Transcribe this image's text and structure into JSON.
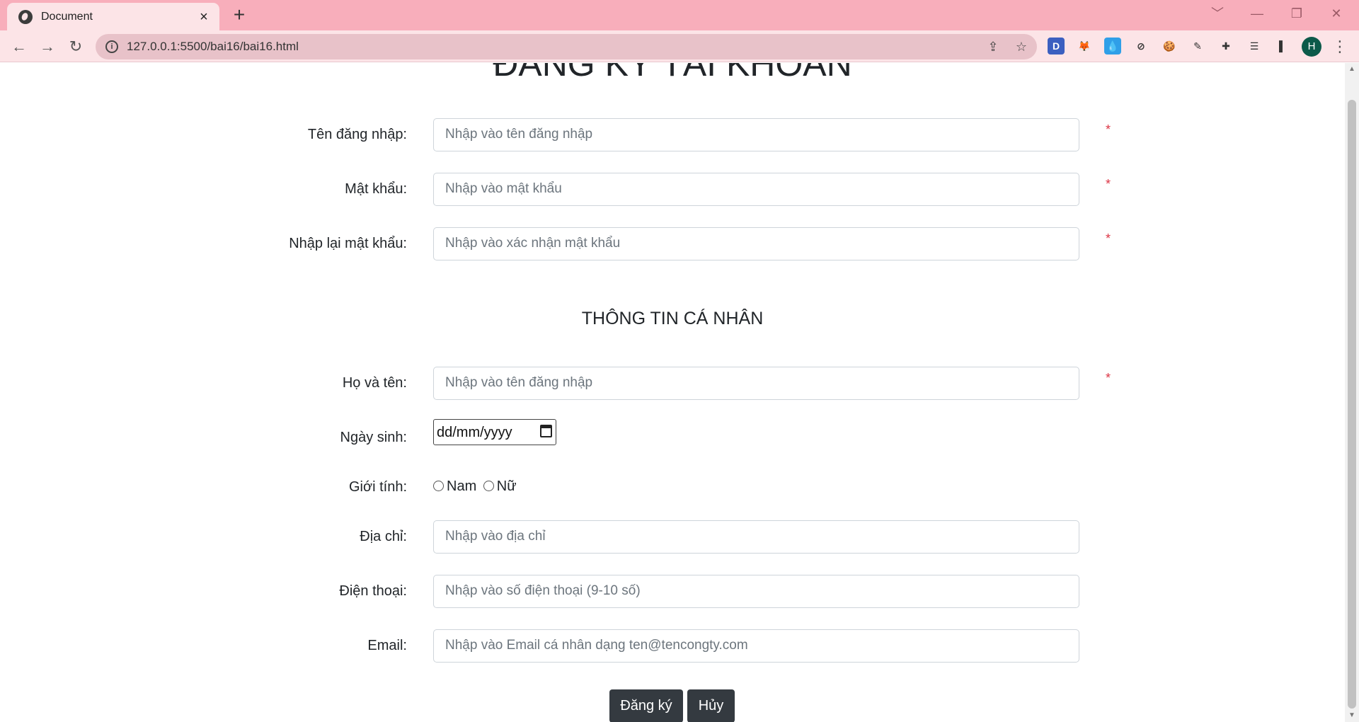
{
  "browser": {
    "tab_title": "Document",
    "tab_close": "×",
    "new_tab": "+",
    "url": "127.0.0.1:5500/bai16/bai16.html",
    "window_controls": [
      "﹀",
      "—",
      "❐",
      "✕"
    ],
    "extensions": [
      {
        "name": "d-extension-icon",
        "glyph": "D",
        "color": "#3b5fc0"
      },
      {
        "name": "metamask-fox-icon",
        "glyph": "🦊",
        "color": "transparent"
      },
      {
        "name": "drop-extension-icon",
        "glyph": "💧",
        "color": "#2f9fe8"
      },
      {
        "name": "compass-extension-icon",
        "glyph": "⊘",
        "color": "transparent"
      },
      {
        "name": "cookie-extension-icon",
        "glyph": "🍪",
        "color": "transparent"
      },
      {
        "name": "eyedropper-extension-icon",
        "glyph": "✎",
        "color": "transparent"
      },
      {
        "name": "puzzle-extensions-icon",
        "glyph": "✚",
        "color": "transparent"
      },
      {
        "name": "reading-list-icon",
        "glyph": "☰",
        "color": "transparent"
      },
      {
        "name": "side-panel-icon",
        "glyph": "▌",
        "color": "transparent"
      }
    ],
    "profile_initial": "H",
    "menu_glyph": "⋮"
  },
  "page": {
    "title": "ĐĂNG KÝ TÀI KHOẢN",
    "account_fields": [
      {
        "label": "Tên đăng nhập:",
        "placeholder": "Nhập vào tên đăng nhập",
        "required": "*"
      },
      {
        "label": "Mật khẩu:",
        "placeholder": "Nhập vào mật khẩu",
        "required": "*"
      },
      {
        "label": "Nhập lại mật khẩu:",
        "placeholder": "Nhập vào xác nhận mật khẩu",
        "required": "*"
      }
    ],
    "section_title": "THÔNG TIN CÁ NHÂN",
    "fullname": {
      "label": "Họ và tên:",
      "placeholder": "Nhập vào tên đăng nhập",
      "required": "*"
    },
    "birthday": {
      "label": "Ngày sinh:",
      "value": "dd/mm/yyyy"
    },
    "gender": {
      "label": "Giới tính:",
      "options": [
        "Nam",
        "Nữ"
      ]
    },
    "address": {
      "label": "Địa chỉ:",
      "placeholder": "Nhập vào địa chỉ"
    },
    "phone": {
      "label": "Điện thoại:",
      "placeholder": "Nhập vào số điện thoại (9-10 số)"
    },
    "email": {
      "label": "Email:",
      "placeholder": "Nhập vào Email cá nhân dạng ten@tencongty.com"
    },
    "buttons": {
      "submit": "Đăng ký",
      "cancel": "Hủy"
    }
  },
  "colors": {
    "titlebar": "#f8aebb",
    "toolbar": "#fce4e7",
    "required": "#dc3545",
    "button": "#343a40"
  }
}
